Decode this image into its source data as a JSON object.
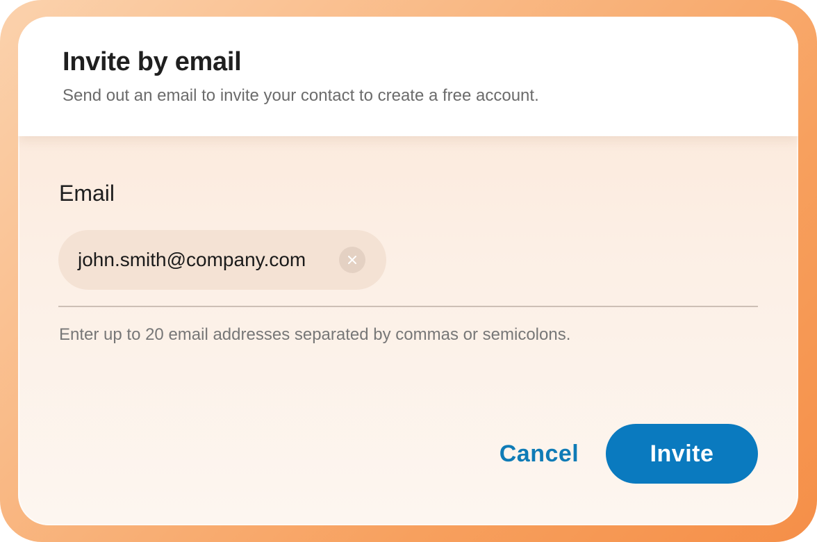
{
  "dialog": {
    "title": "Invite by email",
    "subtitle": "Send out an email to invite your contact to create a free account."
  },
  "email_field": {
    "label": "Email",
    "chips": [
      {
        "value": "john.smith@company.com",
        "remove_icon": "close-icon"
      }
    ],
    "helper_text": "Enter up to 20 email addresses separated by commas or semicolons."
  },
  "actions": {
    "cancel_label": "Cancel",
    "invite_label": "Invite"
  },
  "colors": {
    "accent": "#0a7abf",
    "frame_gradient_start": "#fbd2ad",
    "frame_gradient_end": "#f58f48",
    "chip_background": "#f4e2d4"
  }
}
